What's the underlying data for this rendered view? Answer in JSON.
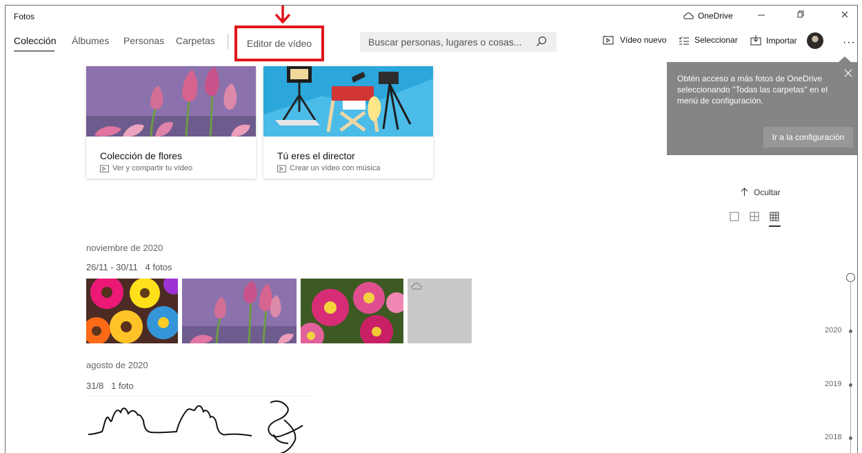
{
  "app": {
    "title": "Fotos",
    "onedrive_label": "OneDrive"
  },
  "nav": {
    "tabs": [
      "Colección",
      "Álbumes",
      "Personas",
      "Carpetas"
    ],
    "editor": "Editor de vídeo"
  },
  "search": {
    "placeholder": "Buscar personas, lugares o cosas..."
  },
  "toolbar": {
    "new_video": "Vídeo nuevo",
    "select": "Seleccionar",
    "import": "Importar",
    "more": "···"
  },
  "cards": [
    {
      "title": "Colección de flores",
      "subtitle": "Ver y compartir tu vídeo"
    },
    {
      "title": "Tú eres el director",
      "subtitle": "Crear un vídeo con música"
    }
  ],
  "tooltip": {
    "text": "Obtén acceso a más fotos de OneDrive seleccionando \"Todas las carpetas\" en el menú de configuración.",
    "button": "Ir a la configuración"
  },
  "hide_label": "Ocultar",
  "groups": [
    {
      "month": "noviembre de 2020",
      "range": "26/11 - 30/11",
      "count": "4 fotos"
    },
    {
      "month": "agosto de 2020",
      "range": "31/8",
      "count": "1 foto"
    }
  ],
  "timeline": {
    "years": [
      "2020",
      "2019",
      "2018"
    ]
  },
  "colors": {
    "accent_red": "#e0141a",
    "tooltip_bg": "#858585",
    "search_bg": "#efefef"
  },
  "icons": {
    "arrow": "down-arrow-icon",
    "onedrive": "cloud-icon",
    "search": "search-icon",
    "video": "video-icon",
    "select": "checklist-icon",
    "import": "import-icon",
    "close": "close-icon"
  }
}
